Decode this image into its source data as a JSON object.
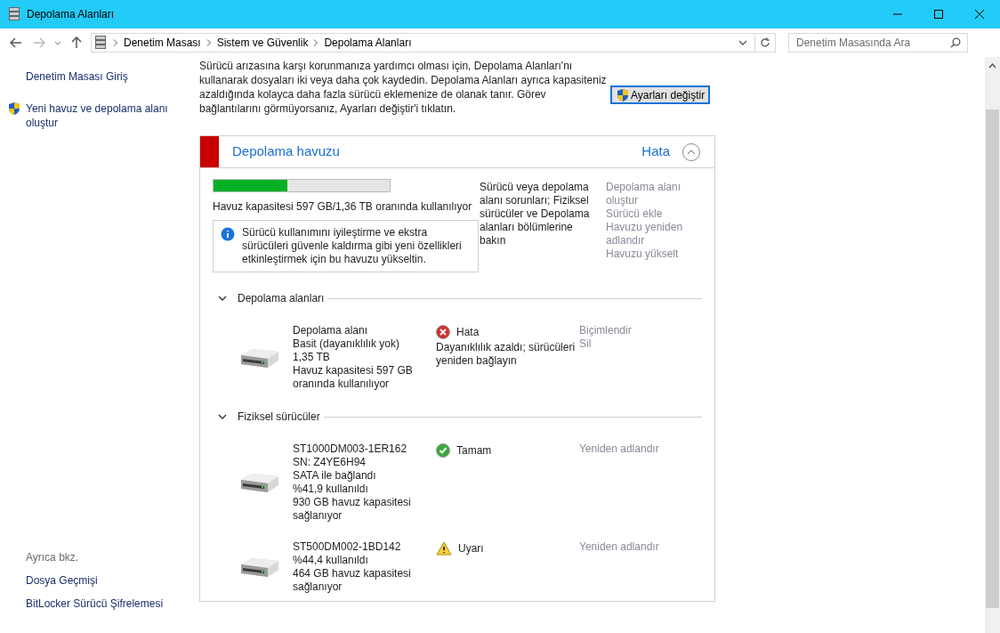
{
  "window": {
    "title": "Depolama Alanları"
  },
  "address": {
    "crumbs": [
      "Denetim Masası",
      "Sistem ve Güvenlik",
      "Depolama Alanları"
    ]
  },
  "search": {
    "placeholder": "Denetim Masasında Ara"
  },
  "sidebar": {
    "links": [
      {
        "label": "Denetim Masası Giriş",
        "shield": false
      },
      {
        "label": "Yeni havuz ve depolama alanı oluştur",
        "shield": true
      }
    ],
    "see_also": {
      "heading": "Ayrıca bkz.",
      "links": [
        "Dosya Geçmişi",
        "BitLocker Sürücü Şifrelemesi"
      ]
    }
  },
  "intro": {
    "lines": [
      "Sürücü arızasına karşı korunmanıza yardımcı olması için, Depolama Alanları'nı",
      "kullanarak dosyaları iki veya daha çok kaydedin. Depolama Alanları ayrıca kapasiteniz",
      "azaldığında kolayca daha fazla sürücü eklemenize de olanak tanır. Görev",
      "bağlantılarını görmüyorsanız, Ayarları değiştir'i tıklatın."
    ],
    "button": "Ayarları değiştir"
  },
  "pool": {
    "title": "Depolama havuzu",
    "status": "Hata",
    "expanded": true,
    "level": 0.42,
    "usage": "Havuz kapasitesi 597 GB/1,36 TB oranında kullanılıyor",
    "info": "Sürücü kullanımını iyileştirme ve ekstra sürücüleri güvenle kaldırma gibi yeni özellikleri etkinleştirmek için bu havuzu yükseltin.",
    "problem": "Sürücü veya depolama alanı sorunları; Fiziksel sürücüler ve Depolama alanları bölümlerine bakın",
    "actions": [
      "Depolama alanı oluştur",
      "Sürücü ekle",
      "Havuzu yeniden adlandır",
      "Havuzu yükselt"
    ],
    "sections": [
      {
        "title": "Depolama alanları",
        "expanded": true,
        "items": [
          {
            "lines": [
              "Depolama alanı",
              "Basit (dayanıklılık yok)",
              "1,35 TB",
              "Havuz kapasitesi 597 GB oranında kullanılıyor"
            ],
            "status": {
              "kind": "error",
              "label": "Hata"
            },
            "detail": "Dayanıklılık azaldı; sürücüleri yeniden bağlayın",
            "actions": [
              "Biçimlendir",
              "Sil"
            ]
          }
        ]
      },
      {
        "title": "Fiziksel sürücüler",
        "expanded": true,
        "items": [
          {
            "lines": [
              "ST1000DM003-1ER162",
              "SN: Z4YE6H94",
              "SATA ile bağlandı",
              "%41,9 kullanıldı",
              "930 GB havuz kapasitesi sağlanıyor"
            ],
            "status": {
              "kind": "ok",
              "label": "Tamam"
            },
            "actions": [
              "Yeniden adlandır"
            ]
          },
          {
            "lines": [
              "ST500DM002-1BD142",
              "%44,4 kullanıldı",
              "464 GB havuz kapasitesi sağlanıyor"
            ],
            "status": {
              "kind": "warning",
              "label": "Uyarı"
            },
            "actions": [
              "Yeniden adlandır"
            ]
          }
        ]
      }
    ]
  }
}
